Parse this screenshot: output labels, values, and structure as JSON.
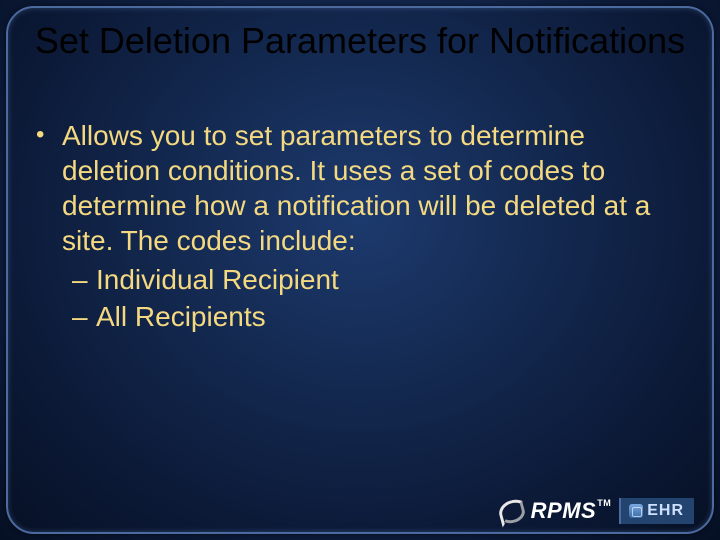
{
  "title": "Set Deletion Parameters for Notifications",
  "bullet": {
    "text": "Allows you to set parameters to determine deletion conditions.  It uses a set of codes to determine how a notification will be deleted at a site. The codes include:",
    "sub": [
      "Individual Recipient",
      "All Recipients"
    ]
  },
  "logo": {
    "rpms": "RPMS",
    "tm": "TM",
    "ehr": "EHR"
  }
}
